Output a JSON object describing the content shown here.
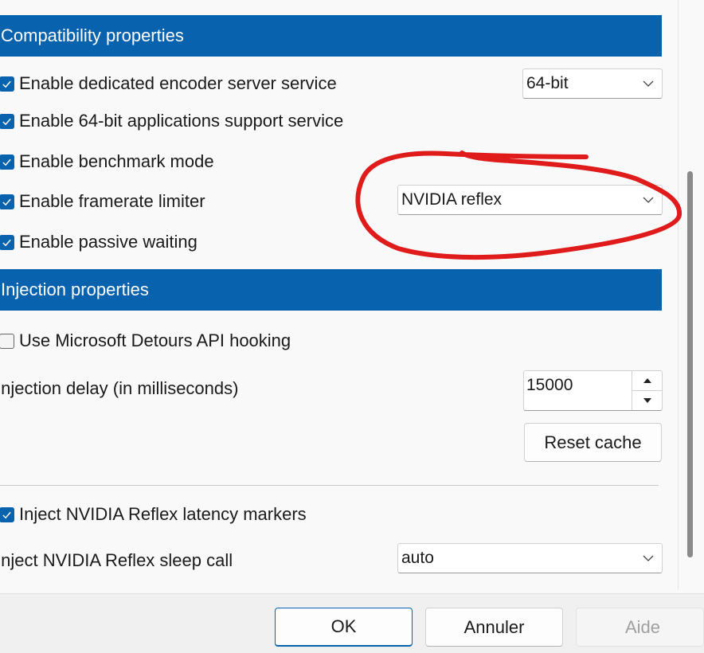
{
  "compat": {
    "title": "Compatibility properties",
    "encoder_label": "Enable dedicated encoder server service",
    "encoder_checked": true,
    "bitness_value": "64-bit",
    "apps64_label": "Enable 64-bit applications support service",
    "apps64_checked": true,
    "benchmark_label": "Enable benchmark mode",
    "benchmark_checked": true,
    "framerate_label": "Enable framerate limiter",
    "framerate_checked": true,
    "limiter_value": "NVIDIA reflex",
    "passive_label": "Enable passive waiting",
    "passive_checked": true
  },
  "injection": {
    "title": "Injection properties",
    "detours_label": "Use Microsoft Detours API hooking",
    "detours_checked": false,
    "delay_label": "Injection delay (in milliseconds)",
    "delay_value": "15000",
    "reset_label": "Reset cache",
    "markers_label": "Inject NVIDIA Reflex latency markers",
    "markers_checked": true,
    "sleep_label": "Inject NVIDIA Reflex sleep call",
    "sleep_value": "auto"
  },
  "footer": {
    "ok_label": "OK",
    "cancel_label": "Annuler",
    "help_label": "Aide"
  },
  "colors": {
    "accent": "#0862ad",
    "annotation": "#e01b1b",
    "disabled_text": "#a0a0a0"
  }
}
